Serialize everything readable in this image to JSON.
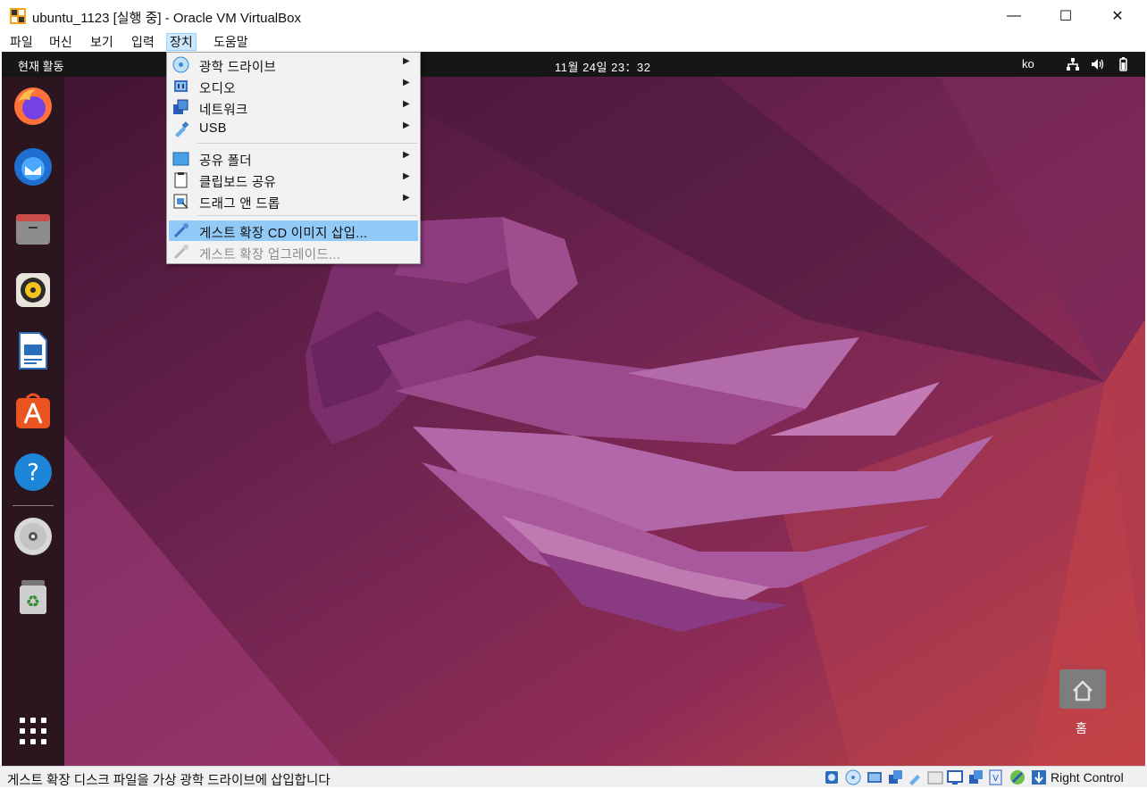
{
  "window": {
    "title": "ubuntu_1123 [실행 중] - Oracle VM VirtualBox",
    "minimize_glyph": "—",
    "maximize_glyph": "☐",
    "close_glyph": "✕"
  },
  "menubar": {
    "items": [
      "파일",
      "머신",
      "보기",
      "입력",
      "장치",
      "도움말"
    ],
    "active": "장치"
  },
  "devices_menu": {
    "items": [
      {
        "label": "광학 드라이브",
        "icon": "optical-drive-icon",
        "submenu": true
      },
      {
        "label": "오디오",
        "icon": "audio-icon",
        "submenu": true
      },
      {
        "label": "네트워크",
        "icon": "network-icon",
        "submenu": true
      },
      {
        "label": "USB",
        "icon": "usb-icon",
        "submenu": true
      },
      {
        "label": "공유 폴더",
        "icon": "shared-folder-icon",
        "submenu": true
      },
      {
        "label": "클립보드 공유",
        "icon": "clipboard-icon",
        "submenu": true
      },
      {
        "label": "드래그 앤 드롭",
        "icon": "drag-drop-icon",
        "submenu": true
      },
      {
        "label": "게스트 확장 CD 이미지 삽입...",
        "icon": "guest-additions-icon",
        "highlighted": true
      },
      {
        "label": "게스트 확장 업그레이드...",
        "icon": "guest-additions-upgrade-icon",
        "disabled": true
      }
    ],
    "submenu_arrow": "▶"
  },
  "guest": {
    "topbar": {
      "activities": "현재 활동",
      "clock": "11월 24일  23：32",
      "lang": "ko"
    },
    "dock": [
      "firefox-icon",
      "thunderbird-icon",
      "files-icon",
      "rhythmbox-icon",
      "libreoffice-writer-icon",
      "app-center-icon",
      "help-icon",
      "dvd-icon",
      "trash-icon",
      "show-apps-icon"
    ],
    "desktop": {
      "home_label": "홈"
    },
    "colors": {
      "topbar": "#161616",
      "dock": "#2b1620",
      "wallpaper_dark": "#4a1836",
      "wallpaper_warm": "#c2414a"
    }
  },
  "statusbar": {
    "message": "게스트 확장 디스크 파일을 가상 광학 드라이브에 삽입합니다",
    "host_key": "Right Control"
  }
}
